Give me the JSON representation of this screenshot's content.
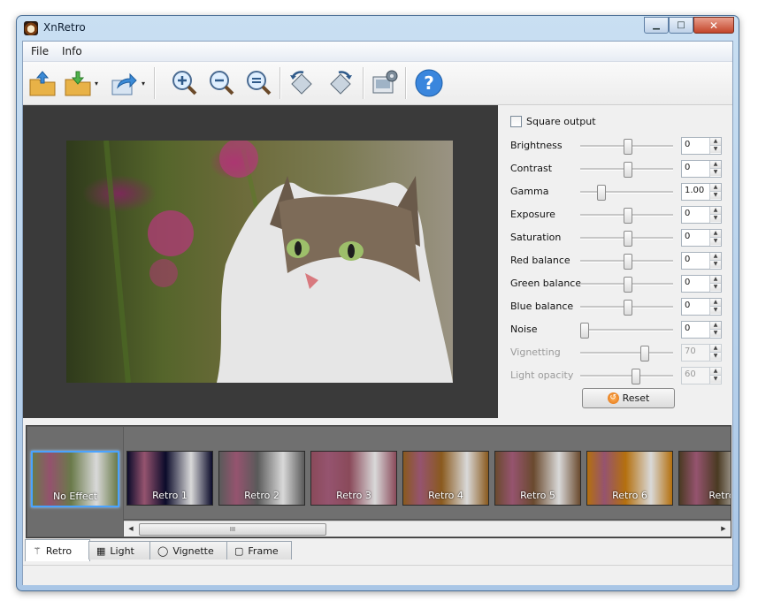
{
  "window": {
    "title": "XnRetro",
    "minimize": "▁",
    "maximize": "□",
    "close": "✕"
  },
  "menu": {
    "file": "File",
    "info": "Info"
  },
  "toolbar": {
    "icons": [
      "open-folder-icon",
      "save-folder-icon",
      "share-icon",
      "zoom-in-icon",
      "zoom-out-icon",
      "zoom-fit-icon",
      "rotate-left-icon",
      "rotate-right-icon",
      "settings-screen-icon",
      "help-icon"
    ],
    "dropdown_arrow": "▾"
  },
  "panel": {
    "square_output": "Square output",
    "sliders": [
      {
        "label": "Brightness",
        "value": "0",
        "level": 0.5,
        "enabled": true
      },
      {
        "label": "Contrast",
        "value": "0",
        "level": 0.5,
        "enabled": true
      },
      {
        "label": "Gamma",
        "value": "1.00",
        "level": 0.2,
        "enabled": true
      },
      {
        "label": "Exposure",
        "value": "0",
        "level": 0.5,
        "enabled": true
      },
      {
        "label": "Saturation",
        "value": "0",
        "level": 0.5,
        "enabled": true
      },
      {
        "label": "Red balance",
        "value": "0",
        "level": 0.5,
        "enabled": true
      },
      {
        "label": "Green balance",
        "value": "0",
        "level": 0.5,
        "enabled": true
      },
      {
        "label": "Blue balance",
        "value": "0",
        "level": 0.5,
        "enabled": true
      },
      {
        "label": "Noise",
        "value": "0",
        "level": 0.0,
        "enabled": true
      },
      {
        "label": "Vignetting",
        "value": "70",
        "level": 0.7,
        "enabled": false
      },
      {
        "label": "Light opacity",
        "value": "60",
        "level": 0.6,
        "enabled": false
      }
    ],
    "reset": "Reset"
  },
  "effects": [
    {
      "label": "No Effect",
      "tint": "#6a7a4a"
    },
    {
      "label": "Retro 1",
      "tint": "#0b0b2a"
    },
    {
      "label": "Retro 2",
      "tint": "#5a5a5a"
    },
    {
      "label": "Retro 3",
      "tint": "#8a4a5a"
    },
    {
      "label": "Retro 4",
      "tint": "#8a5a1e"
    },
    {
      "label": "Retro 5",
      "tint": "#6a4a2e"
    },
    {
      "label": "Retro 6",
      "tint": "#b4700e"
    },
    {
      "label": "Retro",
      "tint": "#4a3a22"
    }
  ],
  "scroll": {
    "left": "◀",
    "right": "▶",
    "grip": "III"
  },
  "tabs": [
    {
      "label": "Retro",
      "icon": "wand-icon",
      "active": true
    },
    {
      "label": "Light",
      "icon": "grid-icon",
      "active": false
    },
    {
      "label": "Vignette",
      "icon": "circle-frame-icon",
      "active": false
    },
    {
      "label": "Frame",
      "icon": "square-frame-icon",
      "active": false
    }
  ]
}
